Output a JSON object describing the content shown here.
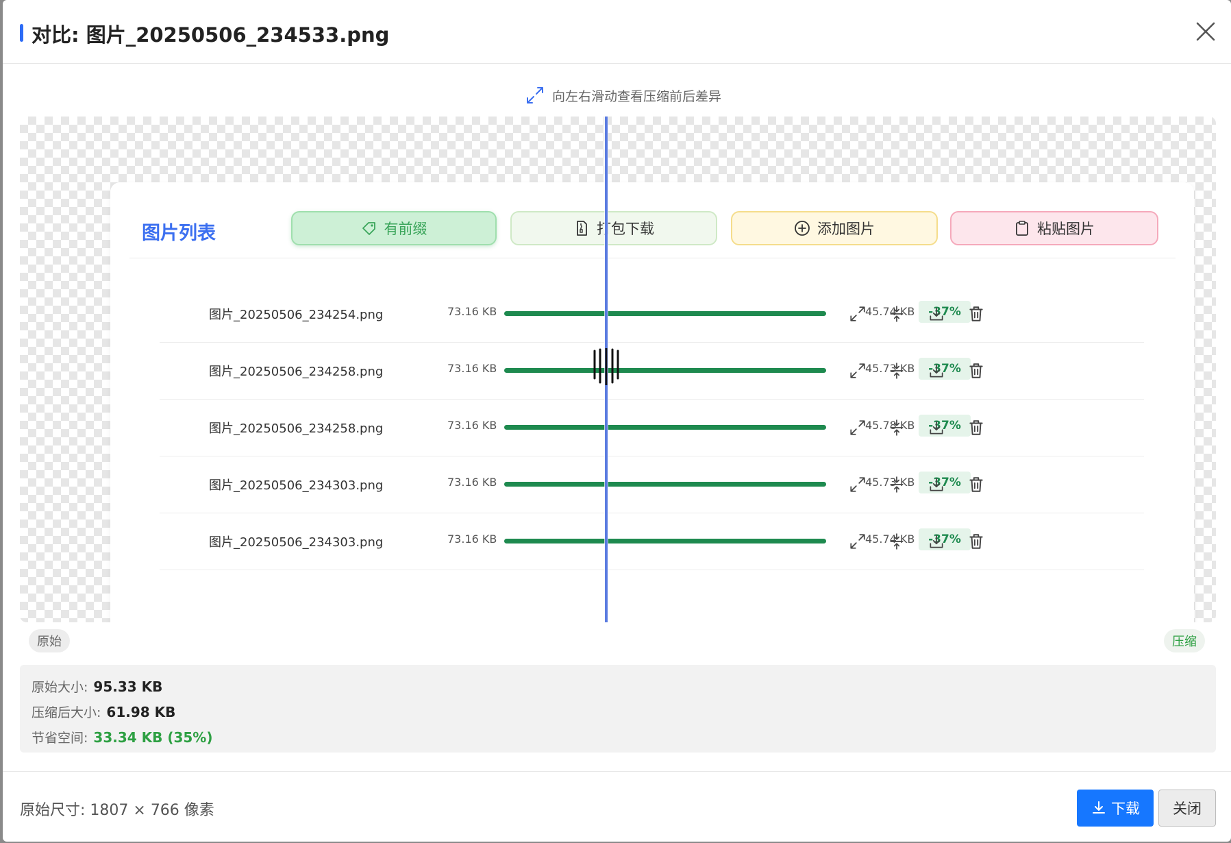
{
  "dialog": {
    "title": "对比: 图片_20250506_234533.png",
    "hint": "向左右滑动查看压缩前后差异"
  },
  "preview": {
    "list_title": "图片列表",
    "toolbar": {
      "prefix_label": "有前缀",
      "pack_download_label": "打包下载",
      "add_image_label": "添加图片",
      "paste_image_label": "粘贴图片"
    },
    "rows": [
      {
        "name": "图片_20250506_234254.png",
        "original": "73.16 KB",
        "compressed": "45.74 KB",
        "percent": "-37%",
        "progress": 100
      },
      {
        "name": "图片_20250506_234258.png",
        "original": "73.16 KB",
        "compressed": "45.73 KB",
        "percent": "-37%",
        "progress": 100
      },
      {
        "name": "图片_20250506_234258.png",
        "original": "73.16 KB",
        "compressed": "45.78 KB",
        "percent": "-37%",
        "progress": 100
      },
      {
        "name": "图片_20250506_234303.png",
        "original": "73.16 KB",
        "compressed": "45.73 KB",
        "percent": "-37%",
        "progress": 100
      },
      {
        "name": "图片_20250506_234303.png",
        "original": "73.16 KB",
        "compressed": "45.74 KB",
        "percent": "-37%",
        "progress": 100
      }
    ],
    "slider_position_percent": 49
  },
  "labels": {
    "original": "原始",
    "compressed": "压缩"
  },
  "stats": {
    "original_label": "原始大小:",
    "original_value": "95.33 KB",
    "compressed_label": "压缩后大小:",
    "compressed_value": "61.98 KB",
    "saved_label": "节省空间:",
    "saved_value": "33.34 KB (35%)"
  },
  "footer": {
    "dimensions": "原始尺寸: 1807 × 766 像素",
    "download_label": "下载",
    "close_label": "关闭"
  },
  "colors": {
    "accent": "#1677ff",
    "title_bar": "#2d6cf6",
    "progress": "#1e8a4f",
    "saved_green": "#2ea043"
  }
}
